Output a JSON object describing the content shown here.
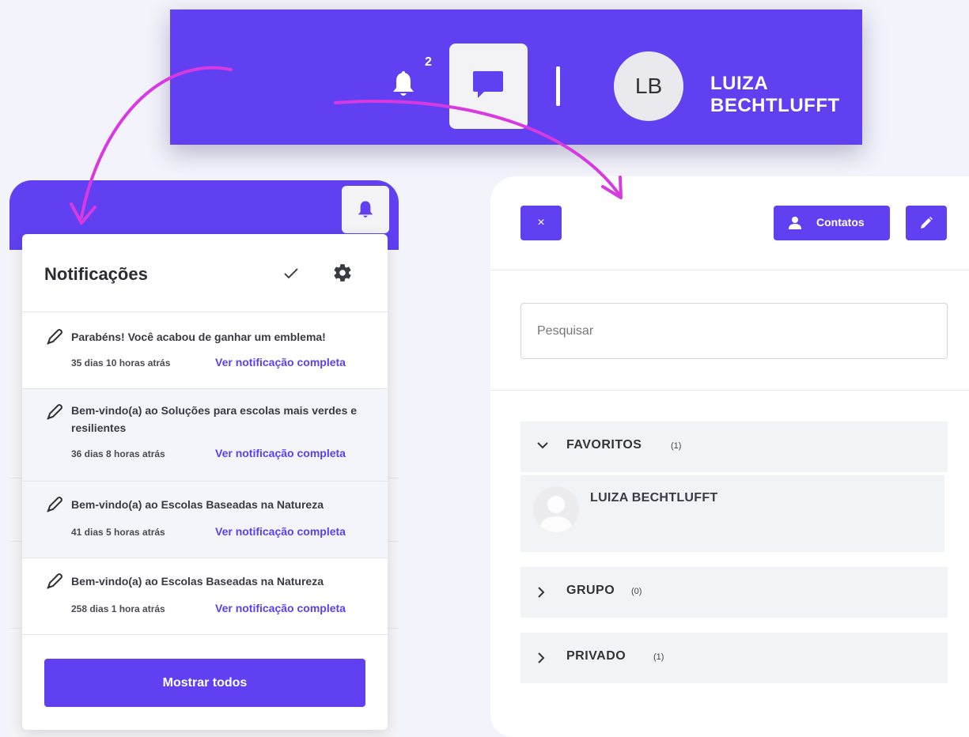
{
  "topbar": {
    "notification_count": "2",
    "avatar_initials": "LB",
    "username": "LUIZA BECHTLUFFT"
  },
  "notifications": {
    "title": "Notificações",
    "items": [
      {
        "message": "Parabéns! Você acabou de ganhar um emblema!",
        "time": "35 dias 10 horas atrás",
        "link": "Ver notificação completa"
      },
      {
        "message": "Bem-vindo(a) ao Soluções para escolas mais verdes e resilientes",
        "time": "36 dias 8 horas atrás",
        "link": "Ver notificação completa"
      },
      {
        "message": "Bem-vindo(a) ao Escolas Baseadas na Natureza",
        "time": "41 dias 5 horas atrás",
        "link": "Ver notificação completa"
      },
      {
        "message": "Bem-vindo(a) ao Escolas Baseadas na Natureza",
        "time": "258 dias 1 hora atrás",
        "link": "Ver notificação completa"
      }
    ],
    "show_all_label": "Mostrar todos"
  },
  "chat": {
    "close_label": "×",
    "contacts_label": "Contatos",
    "search_placeholder": "Pesquisar",
    "sections": [
      {
        "label": "FAVORITOS",
        "count": "(1)",
        "expanded": true
      },
      {
        "label": "GRUPO",
        "count": "(0)",
        "expanded": false
      },
      {
        "label": "PRIVADO",
        "count": "(1)",
        "expanded": false
      }
    ],
    "favorite_contact": "LUIZA BECHTLUFFT"
  },
  "colors": {
    "brand": "#6040f0",
    "arrow": "#d63ae0",
    "link": "#5b3ff0"
  }
}
